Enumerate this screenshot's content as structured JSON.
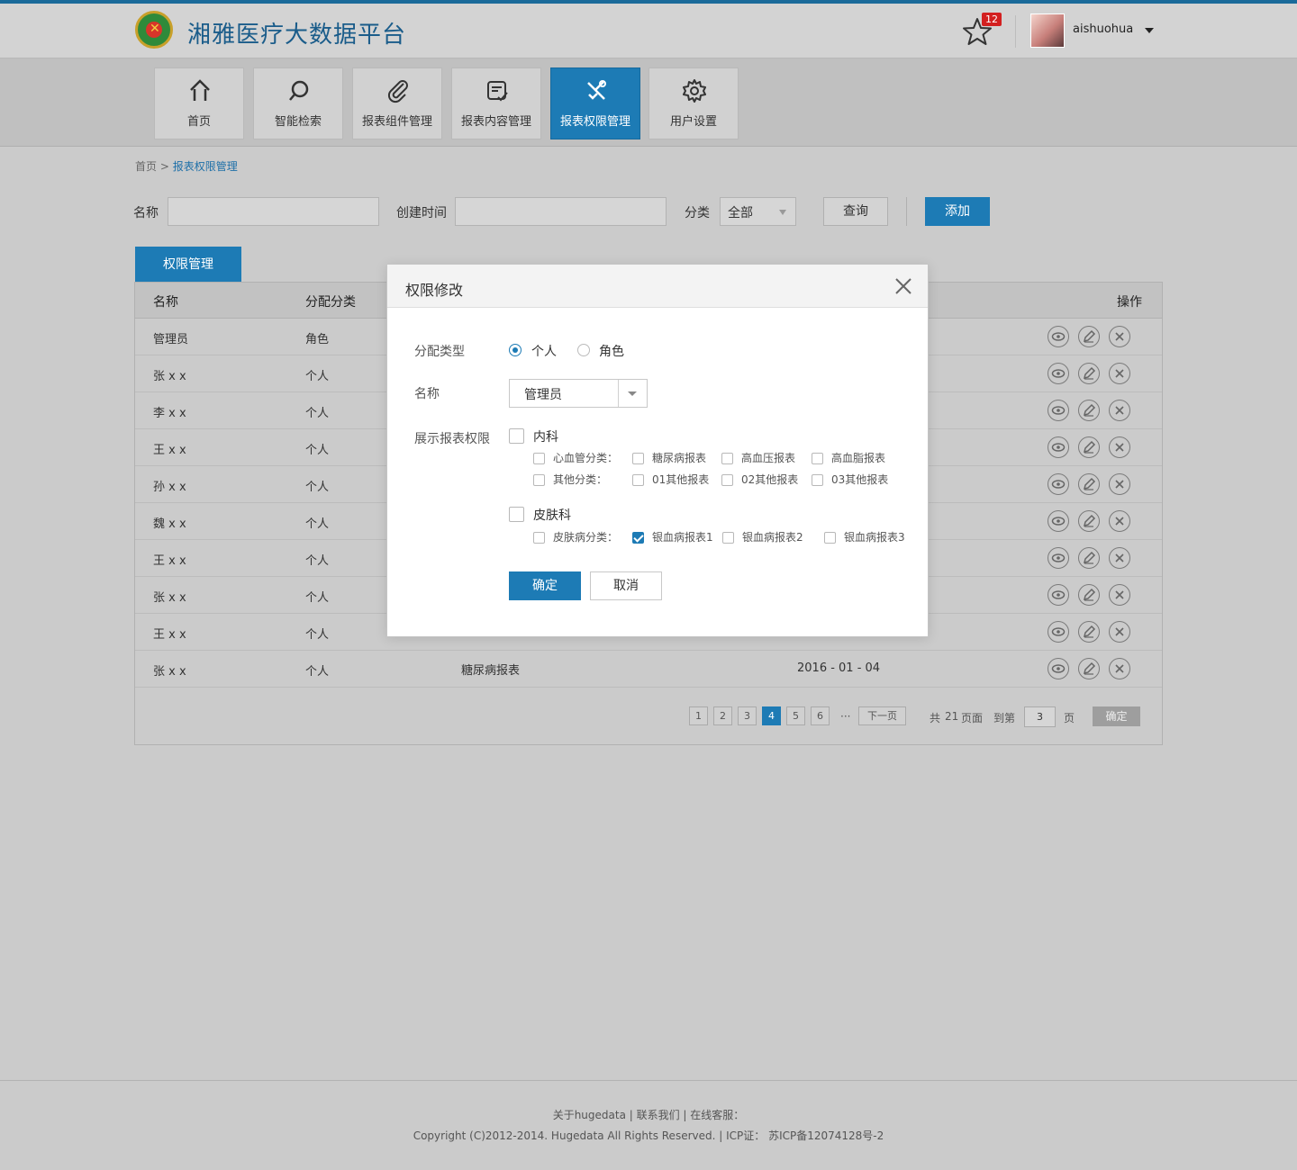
{
  "app": {
    "title": "湘雅医疗大数据平台",
    "accent_color": "#1d7bb5",
    "notification_count": "12",
    "username": "aishuohua"
  },
  "nav": {
    "items": [
      {
        "label": "首页",
        "icon": "home-icon"
      },
      {
        "label": "智能检索",
        "icon": "search-icon"
      },
      {
        "label": "报表组件管理",
        "icon": "paperclip-icon"
      },
      {
        "label": "报表内容管理",
        "icon": "document-check-icon"
      },
      {
        "label": "报表权限管理",
        "icon": "tools-icon",
        "active": true
      },
      {
        "label": "用户设置",
        "icon": "gear-icon"
      }
    ]
  },
  "breadcrumb": {
    "home": "首页",
    "sep": ">",
    "current": "报表权限管理"
  },
  "filters": {
    "name_label": "名称",
    "created_label": "创建时间",
    "category_label": "分类",
    "category_value": "全部",
    "query_button": "查询",
    "add_button": "添加"
  },
  "tab": {
    "label": "权限管理"
  },
  "table": {
    "headers": {
      "name": "名称",
      "assign": "分配分类",
      "ops": "操作"
    },
    "rows": [
      {
        "name": "管理员",
        "assign": "角色",
        "report": "",
        "date": ""
      },
      {
        "name": "张 x x",
        "assign": "个人",
        "report": "",
        "date": ""
      },
      {
        "name": "李 x x",
        "assign": "个人",
        "report": "",
        "date": ""
      },
      {
        "name": "王 x x",
        "assign": "个人",
        "report": "",
        "date": ""
      },
      {
        "name": "孙 x x",
        "assign": "个人",
        "report": "",
        "date": ""
      },
      {
        "name": "魏 x x",
        "assign": "个人",
        "report": "",
        "date": ""
      },
      {
        "name": "王 x x",
        "assign": "个人",
        "report": "",
        "date": ""
      },
      {
        "name": "张 x x",
        "assign": "个人",
        "report": "",
        "date": ""
      },
      {
        "name": "王 x x",
        "assign": "个人",
        "report": "",
        "date": ""
      },
      {
        "name": "张 x x",
        "assign": "个人",
        "report": "糖尿病报表",
        "date": "2016 - 01 - 04"
      }
    ]
  },
  "pager": {
    "pages": [
      "1",
      "2",
      "3",
      "4",
      "5",
      "6"
    ],
    "current": "4",
    "ellipsis": "···",
    "next": "下一页",
    "total_prefix": "共",
    "total": "21",
    "total_suffix": "页面",
    "goto_prefix": "到第",
    "goto_value": "3",
    "goto_suffix": "页",
    "ok": "确定"
  },
  "modal": {
    "title": "权限修改",
    "assign_type_label": "分配类型",
    "assign_options": [
      "个人",
      "角色"
    ],
    "assign_selected": "个人",
    "name_label": "名称",
    "name_value": "管理员",
    "perm_label": "展示报表权限",
    "groups": [
      {
        "label": "内科",
        "checked": false,
        "subs": [
          {
            "label": "心血管分类：",
            "items": [
              "糖尿病报表",
              "高血压报表",
              "高血脂报表"
            ],
            "checked": [
              false,
              false,
              false
            ]
          },
          {
            "label": "其他分类：",
            "items": [
              "01其他报表",
              "02其他报表",
              "03其他报表"
            ],
            "checked": [
              false,
              false,
              false
            ]
          }
        ]
      },
      {
        "label": "皮肤科",
        "checked": false,
        "subs": [
          {
            "label": "皮肤病分类：",
            "items": [
              "银血病报表1",
              "银血病报表2",
              "银血病报表3"
            ],
            "checked": [
              true,
              false,
              false
            ]
          }
        ]
      }
    ],
    "ok_button": "确定",
    "cancel_button": "取消"
  },
  "footer": {
    "line1": "关于hugedata  |   联系我们  |   在线客服：",
    "line2": "Copyright (C)2012-2014. Hugedata All Rights Reserved. | ICP证： 苏ICP备12074128号-2"
  }
}
